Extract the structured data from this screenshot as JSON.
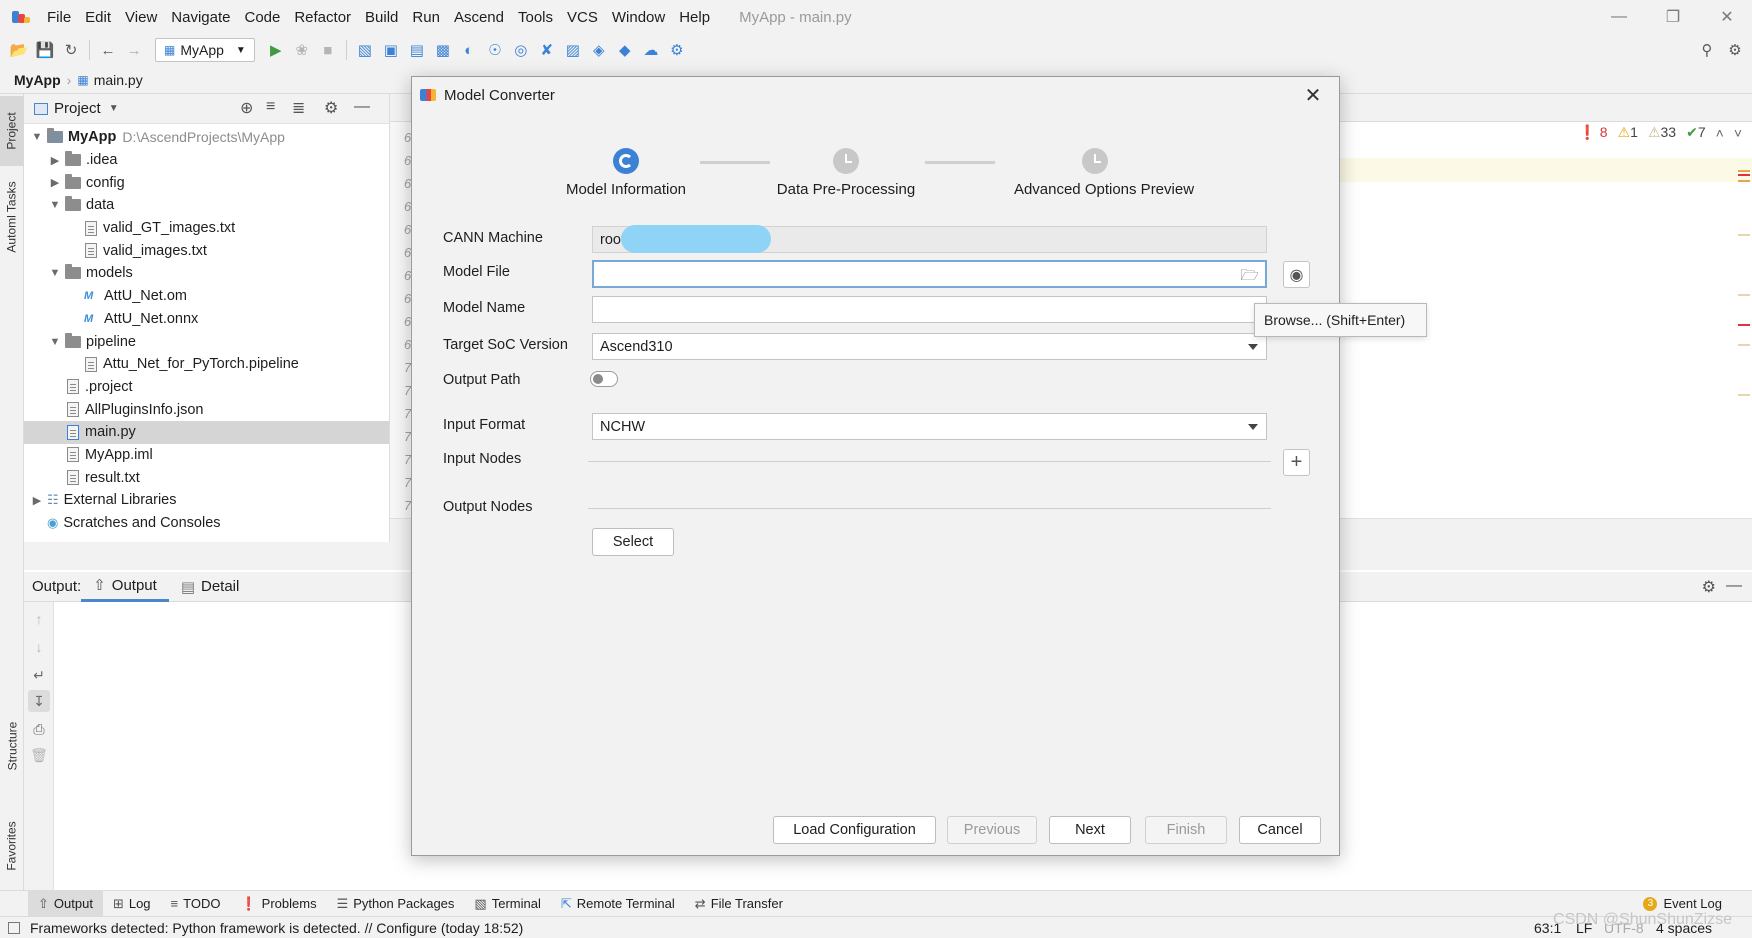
{
  "menu": {
    "items": [
      "File",
      "Edit",
      "View",
      "Navigate",
      "Code",
      "Refactor",
      "Build",
      "Run",
      "Ascend",
      "Tools",
      "VCS",
      "Window",
      "Help"
    ],
    "window_title": "MyApp - main.py"
  },
  "toolbar": {
    "run_config": "MyApp"
  },
  "breadcrumb": {
    "project": "MyApp",
    "file": "main.py"
  },
  "left_strip": {
    "project_tab": "Project",
    "tasks_tab": "Automl Tasks",
    "structure_tab": "Structure",
    "favorites_tab": "Favorites"
  },
  "project_panel": {
    "title": "Project",
    "tree": [
      {
        "label": "MyApp",
        "path": "D:\\AscendProjects\\MyApp"
      },
      {
        "label": ".idea"
      },
      {
        "label": "config"
      },
      {
        "label": "data"
      },
      {
        "label": "valid_GT_images.txt"
      },
      {
        "label": "valid_images.txt"
      },
      {
        "label": "models"
      },
      {
        "label": "AttU_Net.om"
      },
      {
        "label": "AttU_Net.onnx"
      },
      {
        "label": "pipeline"
      },
      {
        "label": "Attu_Net_for_PyTorch.pipeline"
      },
      {
        "label": ".project"
      },
      {
        "label": "AllPluginsInfo.json"
      },
      {
        "label": "main.py"
      },
      {
        "label": "MyApp.iml"
      },
      {
        "label": "result.txt"
      },
      {
        "label": "External Libraries"
      },
      {
        "label": "Scratches and Consoles"
      }
    ]
  },
  "editor": {
    "inspections": {
      "errors": "8",
      "warnings": "1",
      "weak": "33",
      "ok": "7"
    },
    "gutter_digits": [
      "6",
      "6",
      "6",
      "6",
      "6",
      "6",
      "6",
      "6",
      "6",
      "6",
      "7",
      "7",
      "7",
      "7",
      "7",
      "7",
      "7",
      "7"
    ]
  },
  "output": {
    "prefix": "Output:",
    "tabs": [
      "Output",
      "Detail"
    ]
  },
  "dialog": {
    "title": "Model Converter",
    "steps": [
      "Model Information",
      "Data Pre-Processing",
      "Advanced Options  Preview"
    ],
    "labels": {
      "cann_machine": "CANN Machine",
      "model_file": "Model File",
      "model_name": "Model Name",
      "target_soc": "Target SoC Version",
      "output_path": "Output Path",
      "input_format": "Input Format",
      "input_nodes": "Input Nodes",
      "output_nodes": "Output Nodes"
    },
    "values": {
      "cann_machine": "root@",
      "model_file": "",
      "model_name": "",
      "target_soc": "Ascend310",
      "input_format": "NCHW"
    },
    "select_button": "Select",
    "tooltip": "Browse... (Shift+Enter)",
    "buttons": {
      "load": "Load Configuration",
      "previous": "Previous",
      "next": "Next",
      "finish": "Finish",
      "cancel": "Cancel"
    }
  },
  "tool_windows": [
    "Output",
    "Log",
    "TODO",
    "Problems",
    "Python Packages",
    "Terminal",
    "Remote Terminal",
    "File Transfer"
  ],
  "event_log": {
    "count": "3",
    "label": "Event Log"
  },
  "status": {
    "message": "Frameworks detected: Python framework is detected. // Configure (today 18:52)",
    "position": "63:1",
    "line_sep": "LF",
    "encoding": "UTF-8",
    "indent": "4 spaces"
  },
  "watermark": "CSDN @ShunShunZizse",
  "colors": {
    "accent": "#3b82d6",
    "selection": "#d5d5d5",
    "error": "#d9353a",
    "warning": "#e6a817"
  }
}
